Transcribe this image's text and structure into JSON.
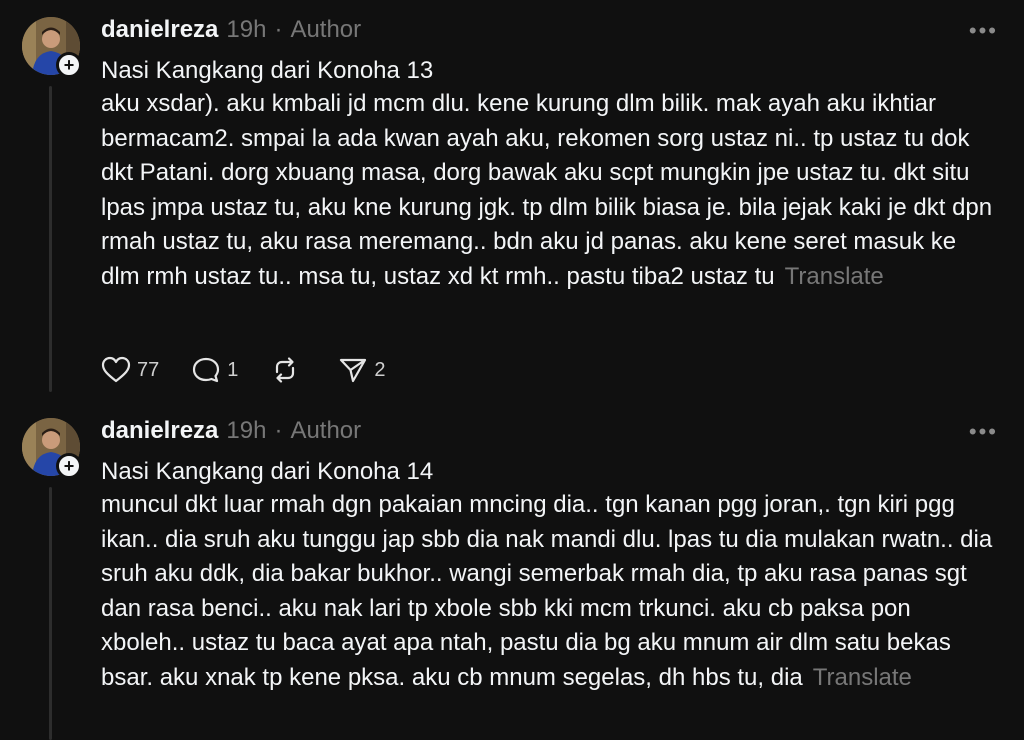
{
  "posts": [
    {
      "username": "danielreza",
      "time": "19h",
      "dot": "·",
      "author_badge": "Author",
      "more": "•••",
      "title": "Nasi Kangkang dari Konoha 13",
      "body": "aku xsdar). aku kmbali jd mcm dlu. kene kurung dlm bilik. mak ayah aku ikhtiar bermacam2. smpai la ada kwan ayah aku, rekomen sorg ustaz ni.. tp ustaz tu dok dkt Patani. dorg xbuang masa, dorg bawak aku scpt mungkin jpe ustaz tu. dkt situ lpas jmpa ustaz tu, aku kne kurung jgk. tp dlm bilik biasa je. bila jejak kaki je dkt dpn rmah ustaz tu, aku rasa meremang.. bdn aku jd panas. aku kene seret masuk ke dlm rmh ustaz tu.. msa tu, ustaz xd kt rmh.. pastu tiba2 ustaz tu",
      "translate": "Translate",
      "likes": "77",
      "replies": "1",
      "shares": "2"
    },
    {
      "username": "danielreza",
      "time": "19h",
      "dot": "·",
      "author_badge": "Author",
      "more": "•••",
      "title": "Nasi Kangkang dari Konoha 14",
      "body": "muncul dkt luar rmah dgn pakaian mncing dia.. tgn kanan pgg joran,. tgn kiri pgg ikan.. dia sruh aku tunggu jap sbb dia nak mandi dlu. lpas tu dia mulakan rwatn.. dia sruh aku ddk, dia bakar bukhor.. wangi semerbak rmah dia, tp aku rasa panas sgt dan rasa benci.. aku nak lari tp xbole sbb kki mcm trkunci. aku cb paksa pon xboleh.. ustaz tu baca ayat apa ntah, pastu dia bg aku mnum air dlm satu bekas bsar. aku xnak tp kene pksa. aku cb mnum segelas, dh hbs tu, dia",
      "translate": "Translate"
    }
  ],
  "icons": [
    "heart-icon",
    "comment-icon",
    "repost-icon",
    "share-icon",
    "plus-icon",
    "more-icon"
  ]
}
